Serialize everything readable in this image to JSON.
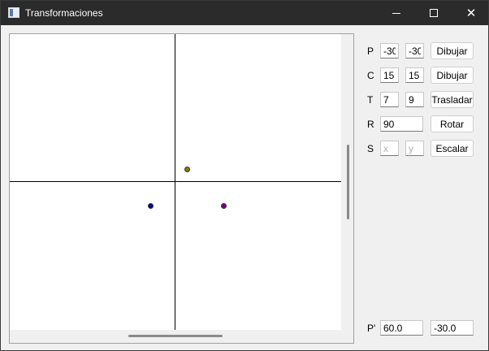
{
  "window": {
    "title": "Transformaciones"
  },
  "canvas": {
    "points": [
      {
        "name": "olive-point",
        "color": "#808000"
      },
      {
        "name": "blue-point",
        "color": "#0000a0"
      },
      {
        "name": "purple-point",
        "color": "#800080"
      }
    ]
  },
  "controls": {
    "point": {
      "label": "P",
      "x": "-30",
      "y": "-30",
      "button": "Dibujar"
    },
    "center": {
      "label": "C",
      "x": "15",
      "y": "15",
      "button": "Dibujar"
    },
    "translate": {
      "label": "T",
      "x": "7",
      "y": "9",
      "button": "Trasladar"
    },
    "rotate": {
      "label": "R",
      "angle": "90",
      "button": "Rotar"
    },
    "scale": {
      "label": "S",
      "x_placeholder": "x",
      "y_placeholder": "y",
      "button": "Escalar"
    },
    "result": {
      "label": "P'",
      "x": "60.0",
      "y": "-30.0"
    }
  }
}
